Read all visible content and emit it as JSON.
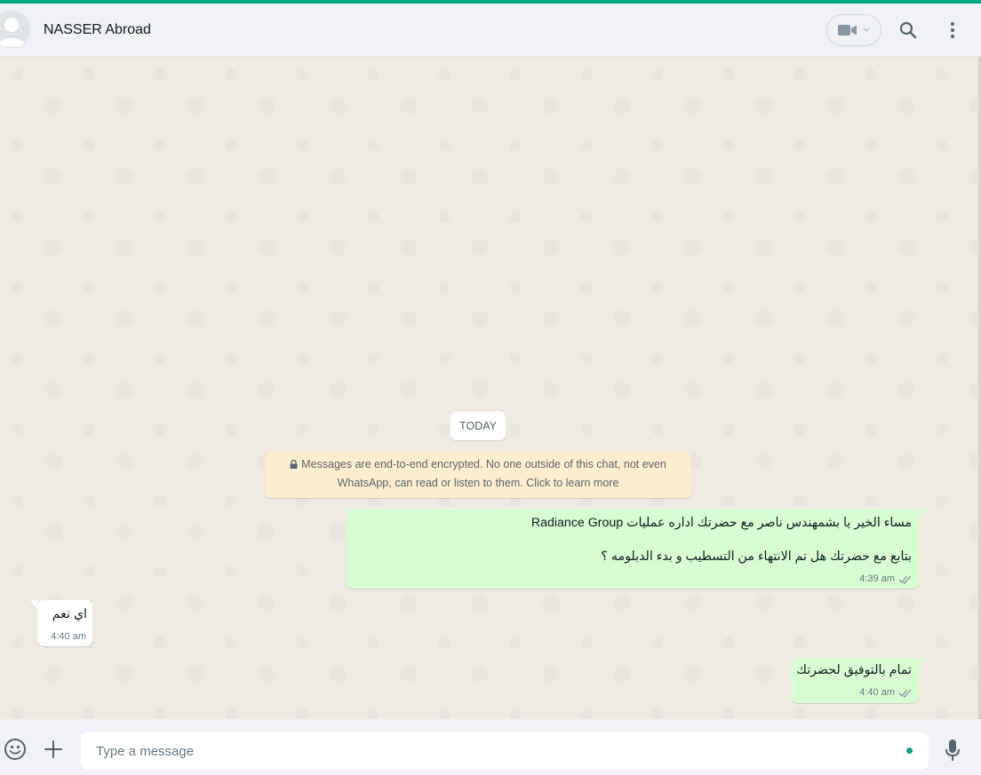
{
  "colors": {
    "accent": "#00a884",
    "outgoing_bubble": "#d9fdd3",
    "incoming_bubble": "#ffffff",
    "encryption_notice": "#ffeecd",
    "read_ticks": "#8696a0"
  },
  "header": {
    "contact_name": "NASSER Abroad",
    "icons": [
      "avatar-icon",
      "video-call-icon",
      "search-icon",
      "menu-icon"
    ]
  },
  "chat": {
    "date_label": "TODAY",
    "encryption_notice": {
      "line1": "Messages are end-to-end encrypted. No one outside of this chat, not even",
      "line2": "WhatsApp, can read or listen to them. Click to learn more"
    },
    "messages": [
      {
        "direction": "outgoing",
        "line1": "مساء الخير يا بشمهندس ناصر مع  حضرتك اداره عمليات Radiance Group",
        "line2": "بتابع مع حضرتك هل تم الانتهاء من التسطيب و بدء الدبلومه ؟",
        "time": "4:39 am",
        "status": "read"
      },
      {
        "direction": "incoming",
        "text": "اي نعم",
        "time": "4:40 am"
      },
      {
        "direction": "outgoing",
        "text": "تمام بالتوفيق لحضرتك",
        "time": "4:40 am",
        "status": "read"
      }
    ]
  },
  "composer": {
    "placeholder": "Type a message",
    "value": ""
  }
}
